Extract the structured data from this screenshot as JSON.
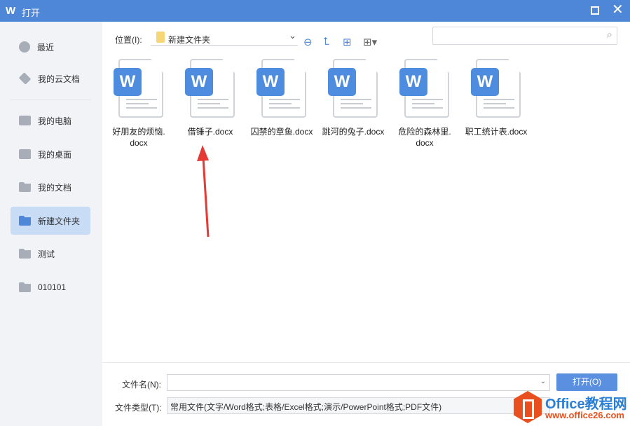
{
  "titlebar": {
    "title": "打开",
    "logo": "W"
  },
  "sidebar": {
    "items": [
      {
        "label": "最近",
        "icon": "clock-icon"
      },
      {
        "label": "我的云文档",
        "icon": "cloud-box-icon"
      },
      {
        "label": "我的电脑",
        "icon": "computer-icon"
      },
      {
        "label": "我的桌面",
        "icon": "desktop-icon"
      },
      {
        "label": "我的文档",
        "icon": "folder-icon"
      },
      {
        "label": "新建文件夹",
        "icon": "folder-icon",
        "selected": true
      },
      {
        "label": "测试",
        "icon": "folder-icon"
      },
      {
        "label": "010101",
        "icon": "folder-icon"
      }
    ]
  },
  "toolbar": {
    "location_label": "位置(I):",
    "location_value": "新建文件夹"
  },
  "files": [
    {
      "name": "好朋友的烦恼.",
      "name2": "docx"
    },
    {
      "name": "借锤子.docx",
      "name2": ""
    },
    {
      "name": "囚禁的章鱼.docx",
      "name2": ""
    },
    {
      "name": "跳河的兔子.docx",
      "name2": ""
    },
    {
      "name": "危险的森林里.",
      "name2": "docx"
    },
    {
      "name": "职工统计表.docx",
      "name2": ""
    }
  ],
  "bottom": {
    "filename_label": "文件名(N):",
    "filename_value": "",
    "open_label": "打开(O)",
    "filetype_label": "文件类型(T):",
    "filetype_value": "常用文件(文字/Word格式;表格/Excel格式;演示/PowerPoint格式;PDF文件)"
  },
  "watermark": {
    "line1": "Office教程网",
    "line2": "www.office26.com"
  },
  "colors": {
    "accent": "#4e86d8",
    "selected": "#c8dcf5",
    "arrow": "#e53935"
  }
}
